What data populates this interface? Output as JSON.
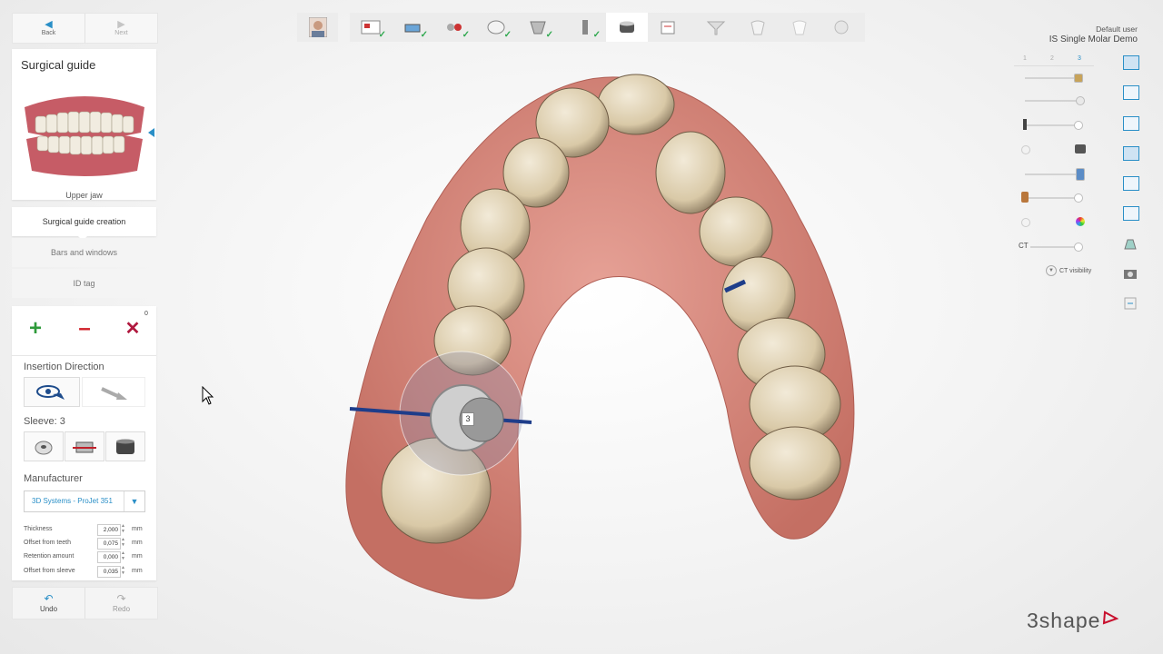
{
  "nav": {
    "back_label": "Back",
    "next_label": "Next"
  },
  "panel": {
    "title": "Surgical guide",
    "jaw_label": "Upper jaw",
    "steps": [
      "Surgical guide creation",
      "Bars and windows",
      "ID tag"
    ]
  },
  "tools": {
    "count_badge": "0",
    "insertion_label": "Insertion Direction",
    "sleeve_label": "Sleeve: 3",
    "manufacturer_label": "Manufacturer",
    "manufacturer_value": "3D Systems - ProJet 351",
    "fields": [
      {
        "label": "Thickness",
        "value": "2,000",
        "unit": "mm"
      },
      {
        "label": "Offset from teeth",
        "value": "0,075",
        "unit": "mm"
      },
      {
        "label": "Retention amount",
        "value": "0,000",
        "unit": "mm"
      },
      {
        "label": "Offset from sleeve",
        "value": "0,035",
        "unit": "mm"
      }
    ],
    "undo_label": "Undo",
    "redo_label": "Redo"
  },
  "header": {
    "user": "Default user",
    "project": "IS Single Molar Demo"
  },
  "view": {
    "tab_numbers": [
      "1",
      "2",
      "3"
    ],
    "ct_label": "CT",
    "ct_visibility_label": "CT visibility"
  },
  "scene": {
    "sleeve_marker": "3"
  },
  "brand": {
    "logo_text": "3shape"
  },
  "colors": {
    "accent": "#2a8fc7",
    "add": "#2e9a3a",
    "remove": "#d0202a",
    "brand": "#c8102e"
  }
}
